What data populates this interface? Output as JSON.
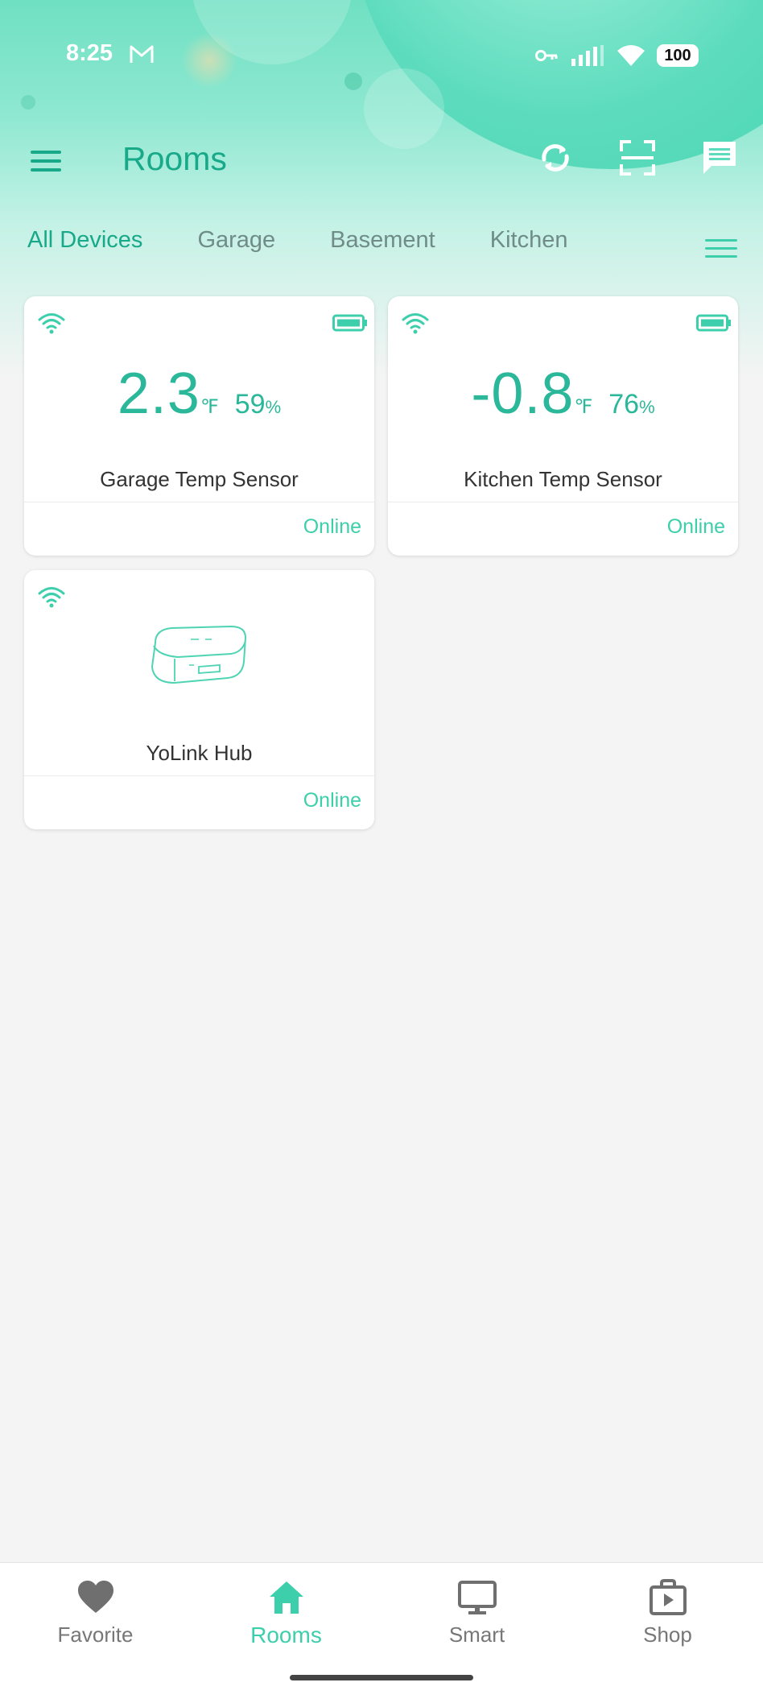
{
  "status_bar": {
    "time": "8:25",
    "battery": "100"
  },
  "app_bar": {
    "title": "Rooms"
  },
  "tabs": [
    {
      "label": "All Devices",
      "active": true
    },
    {
      "label": "Garage",
      "active": false
    },
    {
      "label": "Basement",
      "active": false
    },
    {
      "label": "Kitchen",
      "active": false
    }
  ],
  "devices": [
    {
      "name": "Garage Temp Sensor",
      "temperature": "2.3",
      "temp_unit": "℉",
      "humidity": "59",
      "humidity_unit": "%",
      "status": "Online"
    },
    {
      "name": "Kitchen Temp Sensor",
      "temperature": "-0.8",
      "temp_unit": "℉",
      "humidity": "76",
      "humidity_unit": "%",
      "status": "Online"
    },
    {
      "name": "YoLink Hub",
      "status": "Online"
    }
  ],
  "bottom_nav": [
    {
      "label": "Favorite",
      "icon": "heart-icon",
      "active": false
    },
    {
      "label": "Rooms",
      "icon": "home-icon",
      "active": true
    },
    {
      "label": "Smart",
      "icon": "monitor-icon",
      "active": false
    },
    {
      "label": "Shop",
      "icon": "shop-bag-icon",
      "active": false
    }
  ],
  "colors": {
    "accent": "#17a988",
    "online": "#3dcfab",
    "header_green": "#5ddcbd"
  }
}
